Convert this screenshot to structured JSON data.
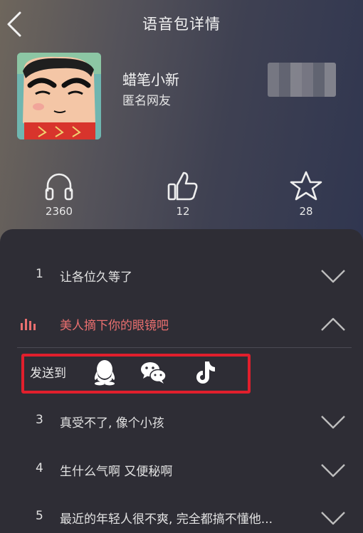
{
  "header": {
    "title": "语音包详情",
    "back_icon": "chevron-left-icon"
  },
  "pack": {
    "name": "蜡笔小新",
    "author": "匿名网友"
  },
  "stats": [
    {
      "icon": "headphones-icon",
      "count": "2360"
    },
    {
      "icon": "thumbs-up-icon",
      "count": "12"
    },
    {
      "icon": "star-icon",
      "count": "28"
    }
  ],
  "tracks": [
    {
      "index": "1",
      "title": "让各位久等了",
      "state": "collapsed"
    },
    {
      "index": "",
      "title": "美人摘下你的眼镜吧",
      "state": "expanded",
      "playing": true
    },
    {
      "index": "3",
      "title": "真受不了, 像个小孩",
      "state": "collapsed"
    },
    {
      "index": "4",
      "title": "生什么气啊 又便秘啊",
      "state": "collapsed"
    },
    {
      "index": "5",
      "title": "最近的年轻人很不爽, 完全都搞不懂他...",
      "state": "collapsed"
    }
  ],
  "share": {
    "label": "发送到",
    "targets": [
      "qq-icon",
      "wechat-icon",
      "tiktok-icon"
    ]
  },
  "colors": {
    "active_track": "#ea6f6f",
    "highlight_border": "#e11f2c",
    "sheet_bg": "#2e2d35"
  }
}
